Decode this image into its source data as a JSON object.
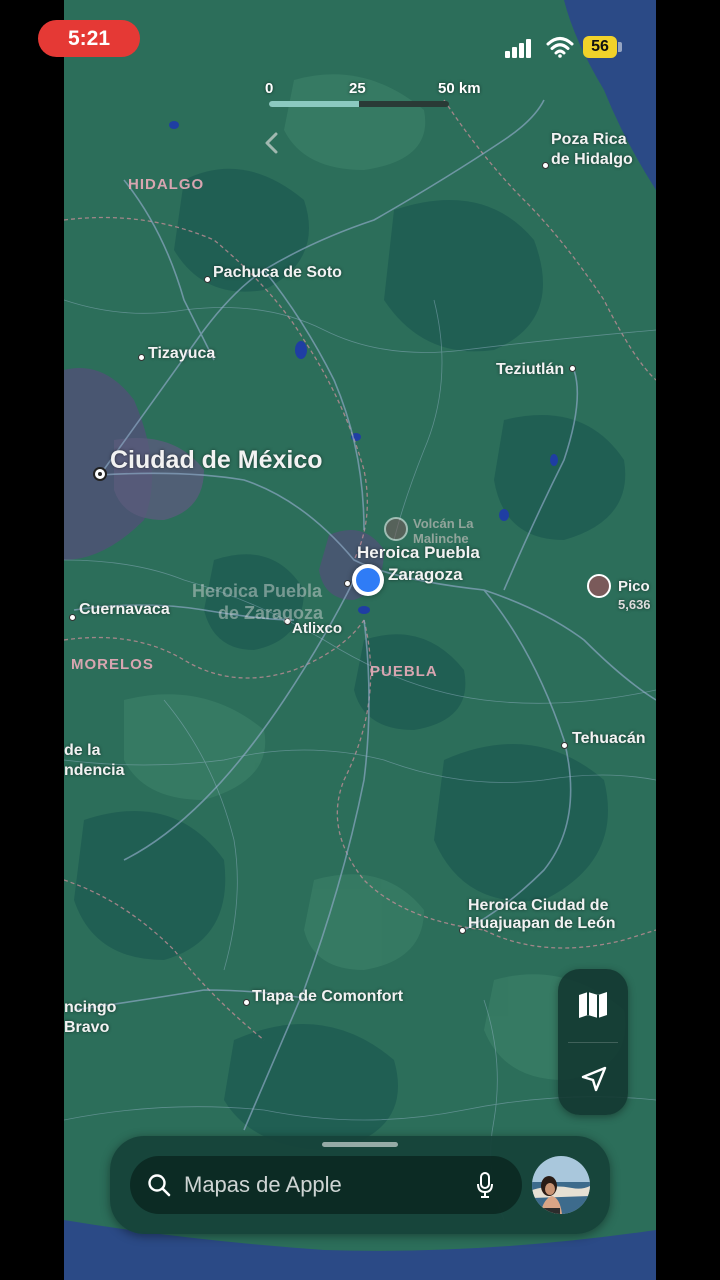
{
  "status_bar": {
    "time": "5:21",
    "battery": "56"
  },
  "map": {
    "scale": {
      "zero": "0",
      "mid": "25",
      "max": "50 km"
    },
    "states": {
      "hidalgo": "HIDALGO",
      "morelos": "MORELOS",
      "puebla": "PUEBLA"
    },
    "cities": {
      "poza_rica_1": "Poza Rica",
      "poza_rica_2": "de Hidalgo",
      "pachuca": "Pachuca de Soto",
      "tizayuca": "Tizayuca",
      "teziutlan": "Teziutlán",
      "cdmx": "Ciudad de México",
      "volcan_1": "Volcán La",
      "volcan_2": "Malinche",
      "puebla_1": "Heroica Puebla",
      "puebla_2": "Zaragoza",
      "puebla_ghost_1": "Heroica Puebla",
      "puebla_ghost_2": "de Zaragoza",
      "pico_1": "Pico",
      "pico_2": "5,636",
      "cuernavaca": "Cuernavaca",
      "atlixco": "Atlixco",
      "tehuacan": "Tehuacán",
      "indep_1": "de la",
      "indep_2": "ndencia",
      "huajuapan_1": "Heroica Ciudad de",
      "huajuapan_2": "Huajuapan de León",
      "tlapa": "Tlapa de Comonfort",
      "chilpancingo_1": "ncingo",
      "chilpancingo_2": "Bravo"
    }
  },
  "search": {
    "placeholder": "Mapas de Apple"
  },
  "icons": {
    "back": "chevron-left-icon",
    "map_mode": "map-icon",
    "locate": "location-arrow-icon",
    "search": "search-icon",
    "mic": "microphone-icon"
  },
  "colors": {
    "map_green": "#2c6e5a",
    "status_red": "#e53935",
    "battery_yellow": "#f1d22a",
    "user_dot": "#2f7cf6"
  }
}
